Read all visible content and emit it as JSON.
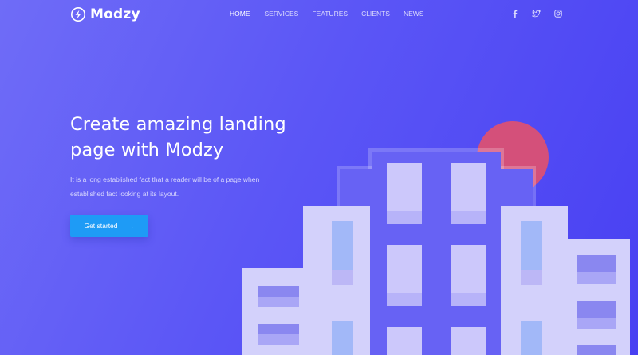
{
  "brand": {
    "name": "Modzy"
  },
  "nav": {
    "items": [
      {
        "label": "HOME",
        "active": true
      },
      {
        "label": "SERVICES",
        "active": false
      },
      {
        "label": "FEATURES",
        "active": false
      },
      {
        "label": "CLIENTS",
        "active": false
      },
      {
        "label": "NEWS",
        "active": false
      }
    ]
  },
  "social": [
    "facebook-icon",
    "twitter-icon",
    "instagram-icon"
  ],
  "hero": {
    "title": "Create amazing landing page with Modzy",
    "description": "It is a long established fact that a reader will be of a page when established fact looking at its layout.",
    "cta_label": "Get started",
    "cta_icon": "arrow-right-icon"
  },
  "colors": {
    "background_start": "#6f6cf7",
    "background_end": "#4840f2",
    "cta": "#1e9bf6",
    "sun": "#d4507a"
  }
}
